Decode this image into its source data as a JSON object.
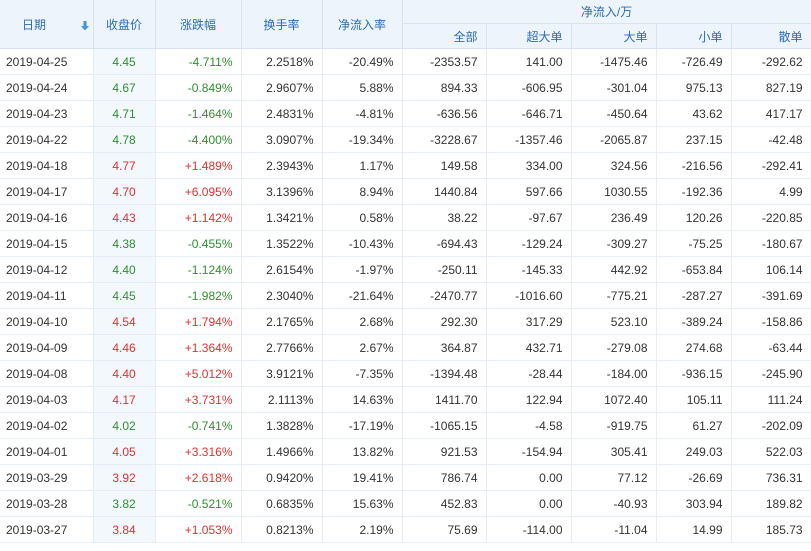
{
  "colors": {
    "up": "#e03131",
    "down": "#2f8f2f",
    "header_text": "#2b6cb7",
    "header_bg": "#edf4fc"
  },
  "header": {
    "date": "日期",
    "close": "收盘价",
    "change_pct": "涨跌幅",
    "turnover": "换手率",
    "net_inflow_rate": "净流入率",
    "net_inflow_group": "净流入/万",
    "sub": {
      "all": "全部",
      "super_large": "超大单",
      "large": "大单",
      "small": "小单",
      "retail": "散单"
    },
    "sort_icon": "arrow-down-icon"
  },
  "rows": [
    {
      "date": "2019-04-25",
      "close": "4.45",
      "change": "-4.711%",
      "turnover": "2.2518%",
      "rate": "-20.49%",
      "all": "-2353.57",
      "super": "141.00",
      "large": "-1475.46",
      "small": "-726.49",
      "retail": "-292.62",
      "dir": "down"
    },
    {
      "date": "2019-04-24",
      "close": "4.67",
      "change": "-0.849%",
      "turnover": "2.9607%",
      "rate": "5.88%",
      "all": "894.33",
      "super": "-606.95",
      "large": "-301.04",
      "small": "975.13",
      "retail": "827.19",
      "dir": "down"
    },
    {
      "date": "2019-04-23",
      "close": "4.71",
      "change": "-1.464%",
      "turnover": "2.4831%",
      "rate": "-4.81%",
      "all": "-636.56",
      "super": "-646.71",
      "large": "-450.64",
      "small": "43.62",
      "retail": "417.17",
      "dir": "down"
    },
    {
      "date": "2019-04-22",
      "close": "4.78",
      "change": "-4.400%",
      "turnover": "3.0907%",
      "rate": "-19.34%",
      "all": "-3228.67",
      "super": "-1357.46",
      "large": "-2065.87",
      "small": "237.15",
      "retail": "-42.48",
      "dir": "down"
    },
    {
      "date": "2019-04-18",
      "close": "4.77",
      "change": "+1.489%",
      "turnover": "2.3943%",
      "rate": "1.17%",
      "all": "149.58",
      "super": "334.00",
      "large": "324.56",
      "small": "-216.56",
      "retail": "-292.41",
      "dir": "up"
    },
    {
      "date": "2019-04-17",
      "close": "4.70",
      "change": "+6.095%",
      "turnover": "3.1396%",
      "rate": "8.94%",
      "all": "1440.84",
      "super": "597.66",
      "large": "1030.55",
      "small": "-192.36",
      "retail": "4.99",
      "dir": "up"
    },
    {
      "date": "2019-04-16",
      "close": "4.43",
      "change": "+1.142%",
      "turnover": "1.3421%",
      "rate": "0.58%",
      "all": "38.22",
      "super": "-97.67",
      "large": "236.49",
      "small": "120.26",
      "retail": "-220.85",
      "dir": "up"
    },
    {
      "date": "2019-04-15",
      "close": "4.38",
      "change": "-0.455%",
      "turnover": "1.3522%",
      "rate": "-10.43%",
      "all": "-694.43",
      "super": "-129.24",
      "large": "-309.27",
      "small": "-75.25",
      "retail": "-180.67",
      "dir": "down"
    },
    {
      "date": "2019-04-12",
      "close": "4.40",
      "change": "-1.124%",
      "turnover": "2.6154%",
      "rate": "-1.97%",
      "all": "-250.11",
      "super": "-145.33",
      "large": "442.92",
      "small": "-653.84",
      "retail": "106.14",
      "dir": "down"
    },
    {
      "date": "2019-04-11",
      "close": "4.45",
      "change": "-1.982%",
      "turnover": "2.3040%",
      "rate": "-21.64%",
      "all": "-2470.77",
      "super": "-1016.60",
      "large": "-775.21",
      "small": "-287.27",
      "retail": "-391.69",
      "dir": "down"
    },
    {
      "date": "2019-04-10",
      "close": "4.54",
      "change": "+1.794%",
      "turnover": "2.1765%",
      "rate": "2.68%",
      "all": "292.30",
      "super": "317.29",
      "large": "523.10",
      "small": "-389.24",
      "retail": "-158.86",
      "dir": "up"
    },
    {
      "date": "2019-04-09",
      "close": "4.46",
      "change": "+1.364%",
      "turnover": "2.7766%",
      "rate": "2.67%",
      "all": "364.87",
      "super": "432.71",
      "large": "-279.08",
      "small": "274.68",
      "retail": "-63.44",
      "dir": "up"
    },
    {
      "date": "2019-04-08",
      "close": "4.40",
      "change": "+5.012%",
      "turnover": "3.9121%",
      "rate": "-7.35%",
      "all": "-1394.48",
      "super": "-28.44",
      "large": "-184.00",
      "small": "-936.15",
      "retail": "-245.90",
      "dir": "up"
    },
    {
      "date": "2019-04-03",
      "close": "4.17",
      "change": "+3.731%",
      "turnover": "2.1113%",
      "rate": "14.63%",
      "all": "1411.70",
      "super": "122.94",
      "large": "1072.40",
      "small": "105.11",
      "retail": "111.24",
      "dir": "up"
    },
    {
      "date": "2019-04-02",
      "close": "4.02",
      "change": "-0.741%",
      "turnover": "1.3828%",
      "rate": "-17.19%",
      "all": "-1065.15",
      "super": "-4.58",
      "large": "-919.75",
      "small": "61.27",
      "retail": "-202.09",
      "dir": "down"
    },
    {
      "date": "2019-04-01",
      "close": "4.05",
      "change": "+3.316%",
      "turnover": "1.4966%",
      "rate": "13.82%",
      "all": "921.53",
      "super": "-154.94",
      "large": "305.41",
      "small": "249.03",
      "retail": "522.03",
      "dir": "up"
    },
    {
      "date": "2019-03-29",
      "close": "3.92",
      "change": "+2.618%",
      "turnover": "0.9420%",
      "rate": "19.41%",
      "all": "786.74",
      "super": "0.00",
      "large": "77.12",
      "small": "-26.69",
      "retail": "736.31",
      "dir": "up"
    },
    {
      "date": "2019-03-28",
      "close": "3.82",
      "change": "-0.521%",
      "turnover": "0.6835%",
      "rate": "15.63%",
      "all": "452.83",
      "super": "0.00",
      "large": "-40.93",
      "small": "303.94",
      "retail": "189.82",
      "dir": "down"
    },
    {
      "date": "2019-03-27",
      "close": "3.84",
      "change": "+1.053%",
      "turnover": "0.8213%",
      "rate": "2.19%",
      "all": "75.69",
      "super": "-114.00",
      "large": "-11.04",
      "small": "14.99",
      "retail": "185.73",
      "dir": "up"
    }
  ]
}
